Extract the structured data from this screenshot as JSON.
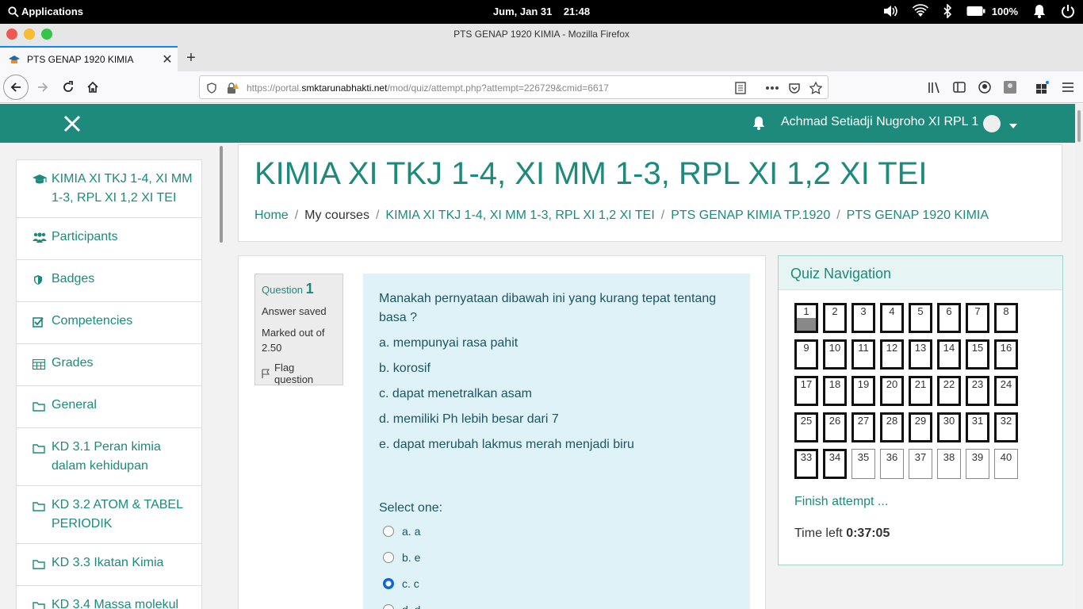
{
  "system_bar": {
    "applications": "Applications",
    "date": "Jum, Jan 31",
    "time": "21:48",
    "battery": "100%"
  },
  "window": {
    "title": "PTS GENAP 1920 KIMIA - Mozilla Firefox"
  },
  "tab": {
    "label": "PTS GENAP 1920 KIMIA"
  },
  "url": {
    "prefix": "https://portal.",
    "domain": "smktarunabhakti.net",
    "path": "/mod/quiz/attempt.php?attempt=226729&cmid=6617"
  },
  "header": {
    "user_name": "Achmad Setiadji Nugroho XI RPL 1"
  },
  "sidebar": {
    "items": [
      {
        "label": "KIMIA XI TKJ 1-4, XI MM 1-3, RPL XI 1,2 XI TEI",
        "icon": "graduation-cap-icon"
      },
      {
        "label": "Participants",
        "icon": "users-icon"
      },
      {
        "label": "Badges",
        "icon": "shield-icon"
      },
      {
        "label": "Competencies",
        "icon": "checkbox-icon"
      },
      {
        "label": "Grades",
        "icon": "table-icon"
      },
      {
        "label": "General",
        "icon": "folder-icon"
      },
      {
        "label": "KD 3.1 Peran kimia dalam kehidupan",
        "icon": "folder-icon"
      },
      {
        "label": "KD 3.2 ATOM & TABEL PERIODIK",
        "icon": "folder-icon"
      },
      {
        "label": "KD 3.3 Ikatan Kimia",
        "icon": "folder-icon"
      },
      {
        "label": "KD 3.4 Massa molekul",
        "icon": "folder-icon"
      }
    ]
  },
  "page": {
    "title": "KIMIA XI TKJ 1-4, XI MM 1-3, RPL XI 1,2 XI TEI",
    "breadcrumb": {
      "home": "Home",
      "my_courses": "My courses",
      "course": "KIMIA XI TKJ 1-4, XI MM 1-3, RPL XI 1,2 XI TEI",
      "section": "PTS GENAP KIMIA TP.1920",
      "quiz": "PTS GENAP 1920 KIMIA"
    }
  },
  "question": {
    "label": "Question",
    "number": "1",
    "state": "Answer saved",
    "marked": "Marked out of 2.50",
    "flag": "Flag question",
    "text": "Manakah pernyataan dibawah ini yang kurang tepat tentang basa ?",
    "choices": [
      "a. mempunyai rasa pahit",
      "b. korosif",
      "c. dapat menetralkan asam",
      "d. memiliki Ph lebih besar dari 7",
      "e. dapat merubah lakmus merah menjadi biru"
    ],
    "select_one": "Select one:",
    "options": [
      {
        "label": "a. a",
        "selected": false
      },
      {
        "label": "b. e",
        "selected": false
      },
      {
        "label": "c. c",
        "selected": true
      },
      {
        "label": "d. d",
        "selected": false
      }
    ]
  },
  "quiz_nav": {
    "title": "Quiz Navigation",
    "buttons": [
      "1",
      "2",
      "3",
      "4",
      "5",
      "6",
      "7",
      "8",
      "9",
      "10",
      "11",
      "12",
      "13",
      "14",
      "15",
      "16",
      "17",
      "18",
      "19",
      "20",
      "21",
      "22",
      "23",
      "24",
      "25",
      "26",
      "27",
      "28",
      "29",
      "30",
      "31",
      "32",
      "33",
      "34",
      "35",
      "36",
      "37",
      "38",
      "39",
      "40"
    ],
    "answered_count": 34,
    "current": "1",
    "finish": "Finish attempt ...",
    "time_label": "Time left",
    "time_value": "0:37:05"
  },
  "colors": {
    "brand": "#1d8a7c",
    "question_bg": "#def2f8"
  }
}
